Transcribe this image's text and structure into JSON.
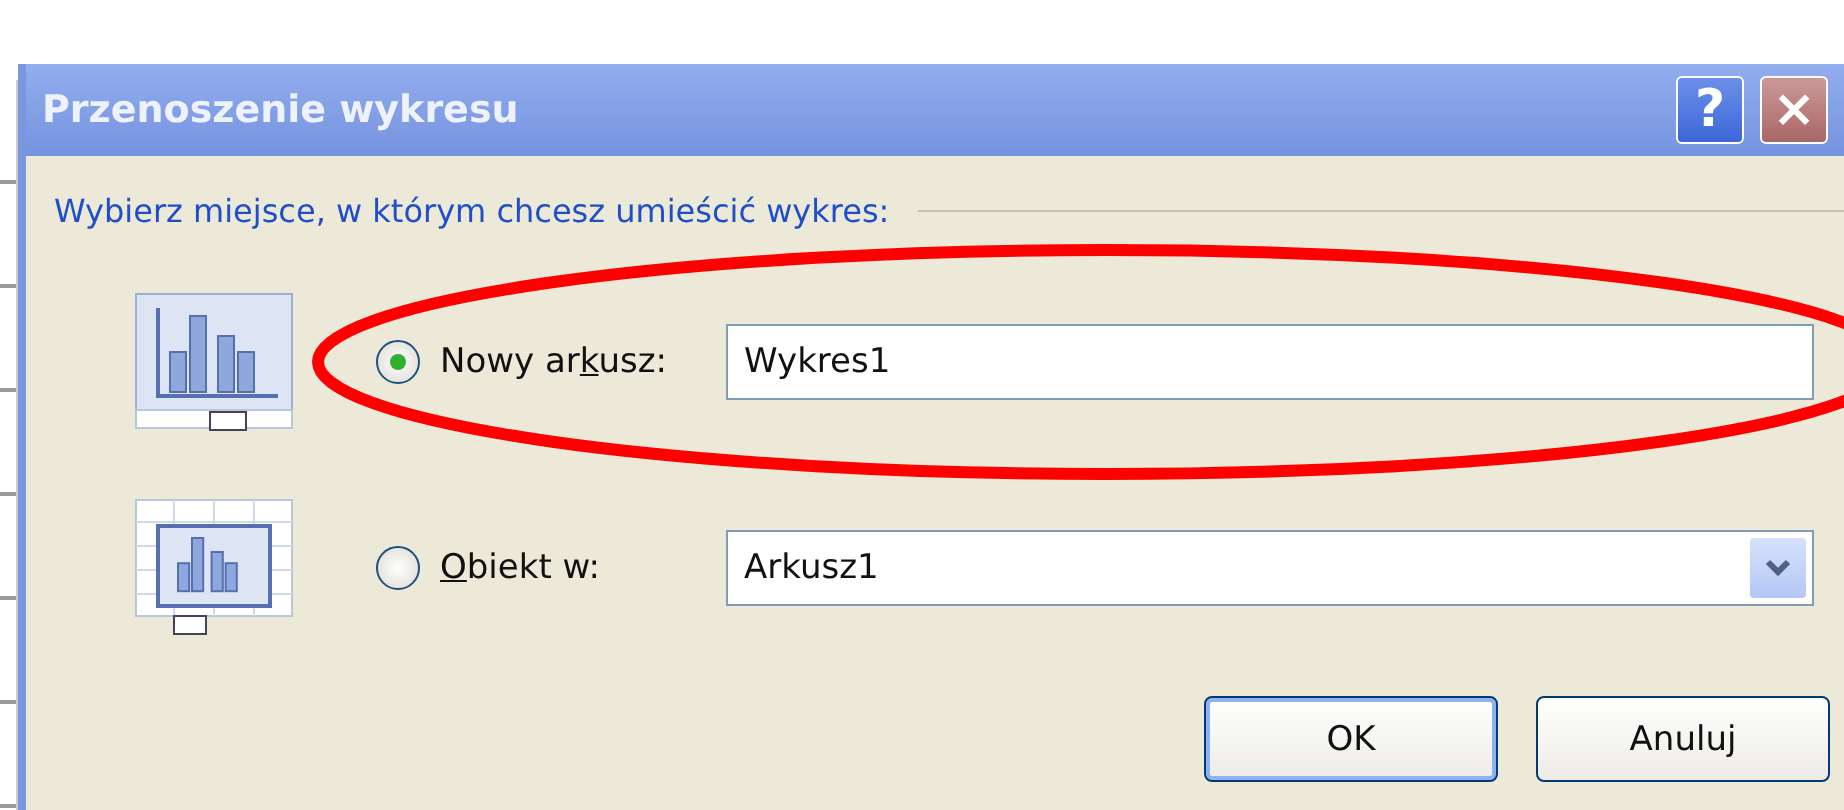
{
  "dialog": {
    "title": "Przenoszenie wykresu",
    "help_button": "?",
    "close_button": "×"
  },
  "prompt": "Wybierz miejsce, w którym chcesz umieścić wykres:",
  "options": [
    {
      "kind": "sheet",
      "label": {
        "before": "Nowy ar",
        "key": "k",
        "after": "usz:"
      },
      "selected": true,
      "circled": true,
      "field": {
        "kind": "text",
        "value": "Wykres1"
      }
    },
    {
      "kind": "object",
      "label": {
        "key": "O",
        "after": "biekt w:"
      },
      "selected": false,
      "circled": false,
      "field": {
        "kind": "combo",
        "value": "Arkusz1"
      }
    }
  ],
  "buttons": [
    {
      "label": "OK",
      "default": true
    },
    {
      "label": "Anuluj",
      "default": false
    }
  ]
}
